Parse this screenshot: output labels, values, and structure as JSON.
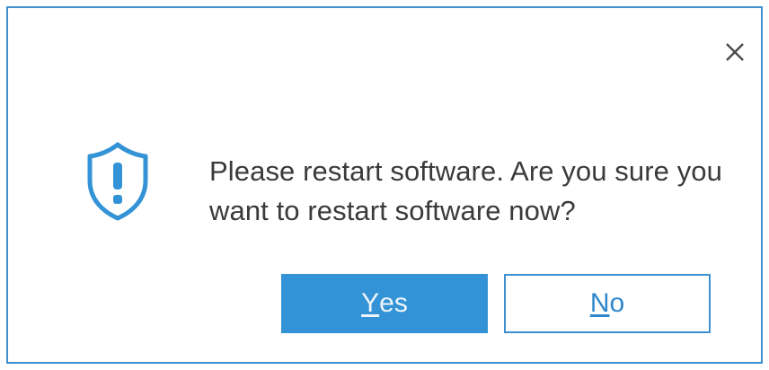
{
  "dialog": {
    "message": "Please restart software. Are you sure you want to restart software now?",
    "yes_button": {
      "mnemonic": "Y",
      "rest": "es"
    },
    "no_button": {
      "mnemonic": "N",
      "rest": "o"
    },
    "icons": {
      "close": "close-icon",
      "warning": "shield-warning-icon"
    },
    "colors": {
      "accent": "#3393d6",
      "border": "#3d8fcf",
      "text": "#3a3a3a"
    }
  }
}
